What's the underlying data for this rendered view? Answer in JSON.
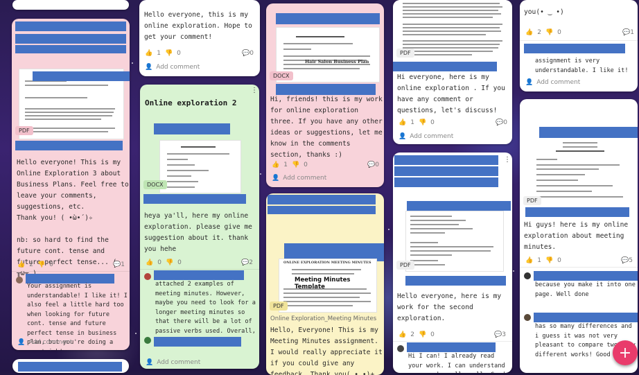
{
  "posts": [
    {
      "body": "Hello everyone! This is my Online Exploration 3 about Business Plans. Feel free to leave your comments, suggestions, etc.\nThank you! ( •̀ω•́ )✧\n\nnb: so hard to find the future cont. tense and future perfect tense... ( ╥ω╥ )",
      "attachment_type": "PDF",
      "likes": "2",
      "dislikes": "0",
      "comment_count": "1",
      "comment": "Your assignment is understandable! I like it! I also feel a little hard too when looking for future cont. tense and future perfect tense in business plan, but you're doing a great job!",
      "add_comment": "Add comment"
    },
    {
      "top_body": "Hello everyone, this is my online exploration. Hope to get your comment!",
      "top_likes": "1",
      "top_dislikes": "0",
      "top_comments": "0",
      "top_add_comment": "Add comment",
      "title": "Online exploration 2",
      "attachment_type": "DOCX",
      "body": "heya ya'll, here my online exploration. please give me suggestion about it. thank you hehe",
      "likes": "0",
      "dislikes": "0",
      "comment_count": "2",
      "comment": "attached 2 examples of meeting minutes. However, maybe you need to look for a longer meeting minutes so that there will be a lot of passive verbs used. Overall, well done!",
      "add_comment": "Add comment"
    },
    {
      "attachment_type": "DOCX",
      "doc_title": "Hair Salon Business Plan",
      "body": "Hi, friends! this is my work for online exploration three. If you have any other ideas or suggestions, let me know in the comments section, thanks :)",
      "likes": "1",
      "dislikes": "0",
      "comment_count": "0",
      "add_comment": "Add comment",
      "doc2_heading": "ONLINE EXPLORATION MEETING MINUTES",
      "doc2_title": "Meeting Minutes Template",
      "attachment2_type": "PDF",
      "caption2": "Online Exploration_Meeting Minutes",
      "body2": "Hello, Everyone! This is my Meeting Minutes assignment. I would really appreciate it if you could give any feedback. Thank you(,•‿•)+"
    },
    {
      "attachment_type": "PDF",
      "body": "Hi everyone, here is my online exploration . If you have any comment or questions, let's discuss!",
      "likes": "1",
      "dislikes": "0",
      "comment_count": "0",
      "add_comment": "Add comment",
      "attachment2_type": "PDF",
      "body2": "Hello everyone, here is my work for the second exploration.",
      "likes2": "2",
      "dislikes2": "0",
      "comment_count2": "3",
      "comment2": "Hi I can! I already read your work. I can understand your work really well. Good job"
    },
    {
      "top_body": "you(• ‿ •)",
      "top_likes": "2",
      "top_dislikes": "0",
      "top_comments": "1",
      "top_comment": "assignment is very understandable. I like it!",
      "top_add_comment": "Add comment",
      "attachment_type": "PDF",
      "body": "Hi guys! here is my online exploration about meeting minutes.",
      "likes": "1",
      "dislikes": "0",
      "comment_count": "5",
      "comment1": "because you make it into one page. Well done",
      "comment2": "has so many differences and i guess it was not very pleasant to compare two very different works! Good job!"
    }
  ],
  "fab_label": "+",
  "colors": {
    "redaction": "#4472c4",
    "pink_card": "#f8d3da",
    "green_card": "#d9f3d2",
    "yellow_card": "#fbf3c6",
    "fab": "#e93b6b"
  }
}
